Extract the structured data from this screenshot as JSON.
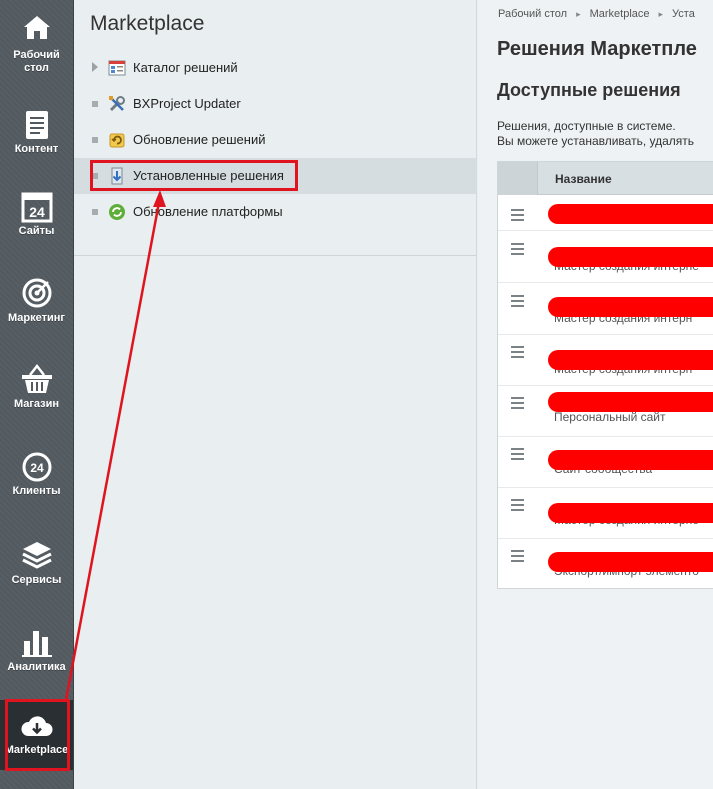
{
  "sidebar": {
    "items": [
      {
        "label": "Рабочий стол",
        "icon": "home-icon"
      },
      {
        "label": "Контент",
        "icon": "document-icon"
      },
      {
        "label": "Сайты",
        "icon": "calendar-24-icon"
      },
      {
        "label": "Маркетинг",
        "icon": "target-icon"
      },
      {
        "label": "Магазин",
        "icon": "basket-icon"
      },
      {
        "label": "Клиенты",
        "icon": "chat-24-icon"
      },
      {
        "label": "Сервисы",
        "icon": "layers-icon"
      },
      {
        "label": "Аналитика",
        "icon": "bar-chart-icon"
      },
      {
        "label": "Marketplace",
        "icon": "cloud-download-icon"
      }
    ]
  },
  "menu": {
    "title": "Marketplace",
    "items": [
      {
        "label": "Каталог решений"
      },
      {
        "label": "BXProject Updater"
      },
      {
        "label": "Обновление решений"
      },
      {
        "label": "Установленные решения"
      },
      {
        "label": "Обновление платформы"
      }
    ]
  },
  "content": {
    "breadcrumb": [
      "Рабочий стол",
      "Marketplace",
      "Уста"
    ],
    "title": "Решения Маркетпле",
    "subtitle": "Доступные решения",
    "description_line1": "Решения, доступные в системе.",
    "description_line2": "Вы можете устанавливать, удалять",
    "table": {
      "column_name": "Название",
      "rows": [
        {
          "text": ""
        },
        {
          "text": "Мастер создания интерне"
        },
        {
          "text": "Мастер создания интерн"
        },
        {
          "text": "Мастер создания интерн"
        },
        {
          "text": "Персональный сайт"
        },
        {
          "text": "Сайт сообщества"
        },
        {
          "text": "Мастер создания интерне"
        },
        {
          "text": "Экспорт/импорт элементо"
        }
      ]
    }
  },
  "colors": {
    "sidebar_bg": "#525a60",
    "annotation_red": "#e0141e",
    "redaction_red": "#ff0000"
  }
}
